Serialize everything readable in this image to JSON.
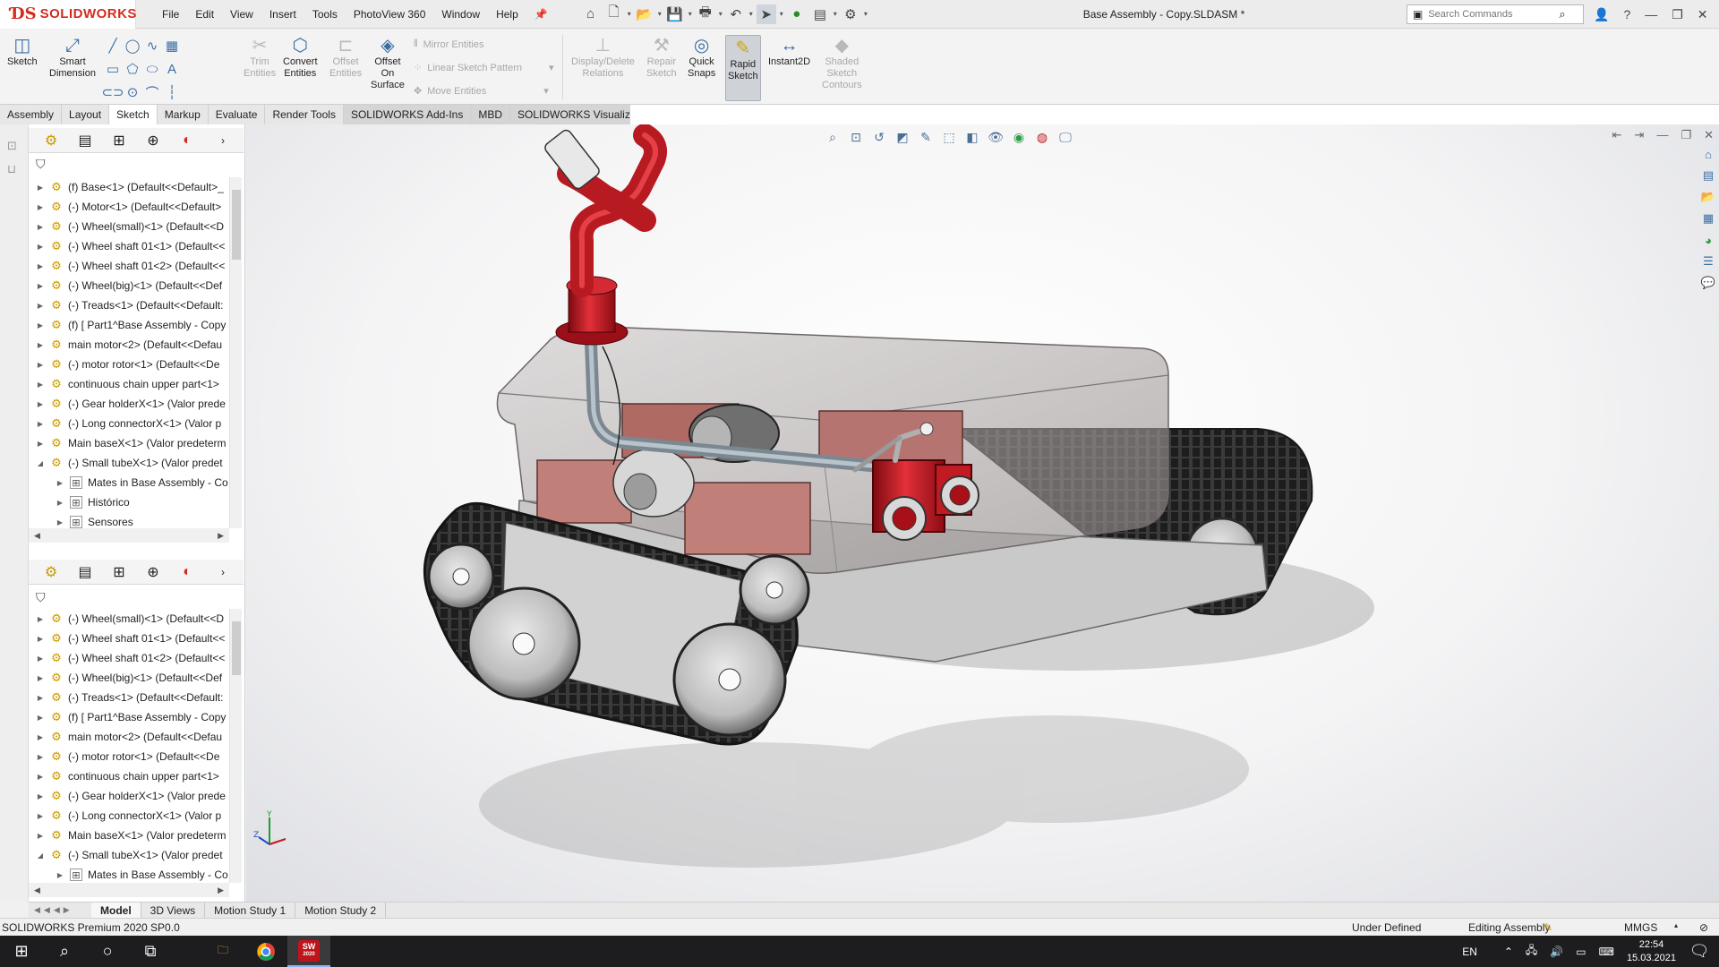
{
  "titlebar": {
    "brand": "SOLIDWORKS",
    "menus": [
      "File",
      "Edit",
      "View",
      "Insert",
      "Tools",
      "PhotoView 360",
      "Window",
      "Help"
    ],
    "document_title": "Base Assembly - Copy.SLDASM *",
    "search_placeholder": "Search Commands"
  },
  "commandmanager": {
    "sketch": "Sketch",
    "smart_dimension": [
      "Smart",
      "Dimension"
    ],
    "trim_entities": [
      "Trim",
      "Entities"
    ],
    "convert_entities": [
      "Convert",
      "Entities"
    ],
    "offset_entities": [
      "Offset",
      "Entities"
    ],
    "offset_on_surface": [
      "Offset",
      "On",
      "Surface"
    ],
    "mirror_entities": "Mirror Entities",
    "linear_sketch_pattern": "Linear Sketch Pattern",
    "move_entities": "Move Entities",
    "display_delete_relations": [
      "Display/Delete",
      "Relations"
    ],
    "repair_sketch": [
      "Repair",
      "Sketch"
    ],
    "quick_snaps": [
      "Quick",
      "Snaps"
    ],
    "rapid_sketch": [
      "Rapid",
      "Sketch"
    ],
    "instant2d": "Instant2D",
    "shaded_sketch_contours": [
      "Shaded",
      "Sketch",
      "Contours"
    ]
  },
  "tabs": [
    "Assembly",
    "Layout",
    "Sketch",
    "Markup",
    "Evaluate",
    "Render Tools",
    "SOLIDWORKS Add-Ins",
    "MBD",
    "SOLIDWORKS Visualize"
  ],
  "active_tab": "Sketch",
  "tree_top": [
    {
      "label": "(f) Base<1> (Default<<Default>_",
      "expanded": false
    },
    {
      "label": "(-) Motor<1> (Default<<Default>",
      "expanded": false
    },
    {
      "label": "(-) Wheel(small)<1> (Default<<D",
      "expanded": false
    },
    {
      "label": "(-) Wheel shaft 01<1> (Default<<",
      "expanded": false
    },
    {
      "label": "(-) Wheel shaft 01<2> (Default<<",
      "expanded": false
    },
    {
      "label": "(-) Wheel(big)<1> (Default<<Def",
      "expanded": false
    },
    {
      "label": "(-) Treads<1> (Default<<Default:",
      "expanded": false
    },
    {
      "label": "(f) [ Part1^Base Assembly - Copy",
      "expanded": false
    },
    {
      "label": "main motor<2> (Default<<Defau",
      "expanded": false
    },
    {
      "label": "(-) motor rotor<1> (Default<<De",
      "expanded": false
    },
    {
      "label": "continuous chain upper part<1>",
      "expanded": false
    },
    {
      "label": "(-) Gear holderX<1> (Valor prede",
      "expanded": false
    },
    {
      "label": "(-) Long connectorX<1> (Valor p",
      "expanded": false
    },
    {
      "label": "Main baseX<1> (Valor predeterm",
      "expanded": false
    },
    {
      "label": "(-) Small tubeX<1> (Valor predet",
      "expanded": true
    }
  ],
  "tree_top_children": [
    "Mates in Base Assembly - Co",
    "Histórico",
    "Sensores"
  ],
  "tree_bottom": [
    {
      "label": "(-) Wheel(small)<1> (Default<<D",
      "expanded": false
    },
    {
      "label": "(-) Wheel shaft 01<1> (Default<<",
      "expanded": false
    },
    {
      "label": "(-) Wheel shaft 01<2> (Default<<",
      "expanded": false
    },
    {
      "label": "(-) Wheel(big)<1> (Default<<Def",
      "expanded": false
    },
    {
      "label": "(-) Treads<1> (Default<<Default:",
      "expanded": false
    },
    {
      "label": "(f) [ Part1^Base Assembly - Copy",
      "expanded": false
    },
    {
      "label": "main motor<2> (Default<<Defau",
      "expanded": false
    },
    {
      "label": "(-) motor rotor<1> (Default<<De",
      "expanded": false
    },
    {
      "label": "continuous chain upper part<1>",
      "expanded": false
    },
    {
      "label": "(-) Gear holderX<1> (Valor prede",
      "expanded": false
    },
    {
      "label": "(-) Long connectorX<1> (Valor p",
      "expanded": false
    },
    {
      "label": "Main baseX<1> (Valor predeterm",
      "expanded": false
    },
    {
      "label": "(-) Small tubeX<1> (Valor predet",
      "expanded": true
    }
  ],
  "tree_bottom_children": [
    "Mates in Base Assembly - Co"
  ],
  "bottom_tabs": [
    "Model",
    "3D Views",
    "Motion Study 1",
    "Motion Study 2"
  ],
  "status": {
    "product": "SOLIDWORKS Premium 2020 SP0.0",
    "definition": "Under Defined",
    "mode": "Editing Assembly",
    "units": "MMGS"
  },
  "taskbar": {
    "language": "EN",
    "time": "22:54",
    "date": "15.03.2021",
    "sw_badge": "2020"
  },
  "colors": {
    "brand_red": "#d52b1e",
    "accent_blue": "#3b6ea5",
    "model_red": "#c0141c"
  }
}
